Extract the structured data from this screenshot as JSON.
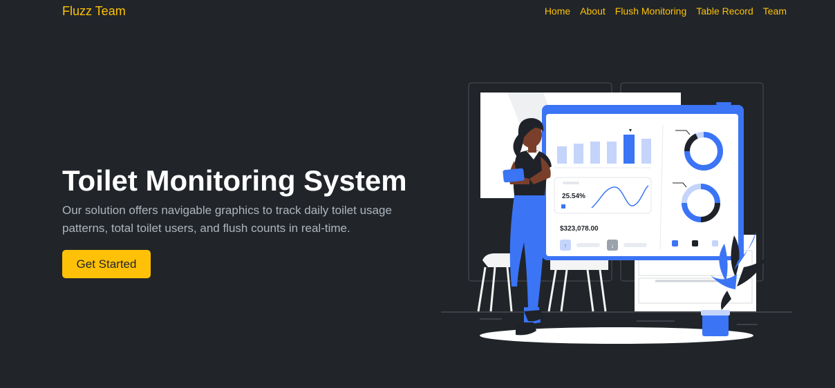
{
  "navbar": {
    "brand": "Fluzz Team",
    "links": [
      "Home",
      "About",
      "Flush Monitoring",
      "Table Record",
      "Team"
    ]
  },
  "hero": {
    "title": "Toilet Monitoring System",
    "description": "Our solution offers navigable graphics to track daily toilet usage patterns, total toilet users, and flush counts in real-time.",
    "cta_label": "Get Started"
  },
  "illustration": {
    "percent_label": "25.54%",
    "amount_label": "$323,078.00"
  },
  "colors": {
    "background": "#212529",
    "accent": "#ffc107",
    "illustration_blue": "#3b74f5",
    "text_muted": "#adb5bd"
  }
}
